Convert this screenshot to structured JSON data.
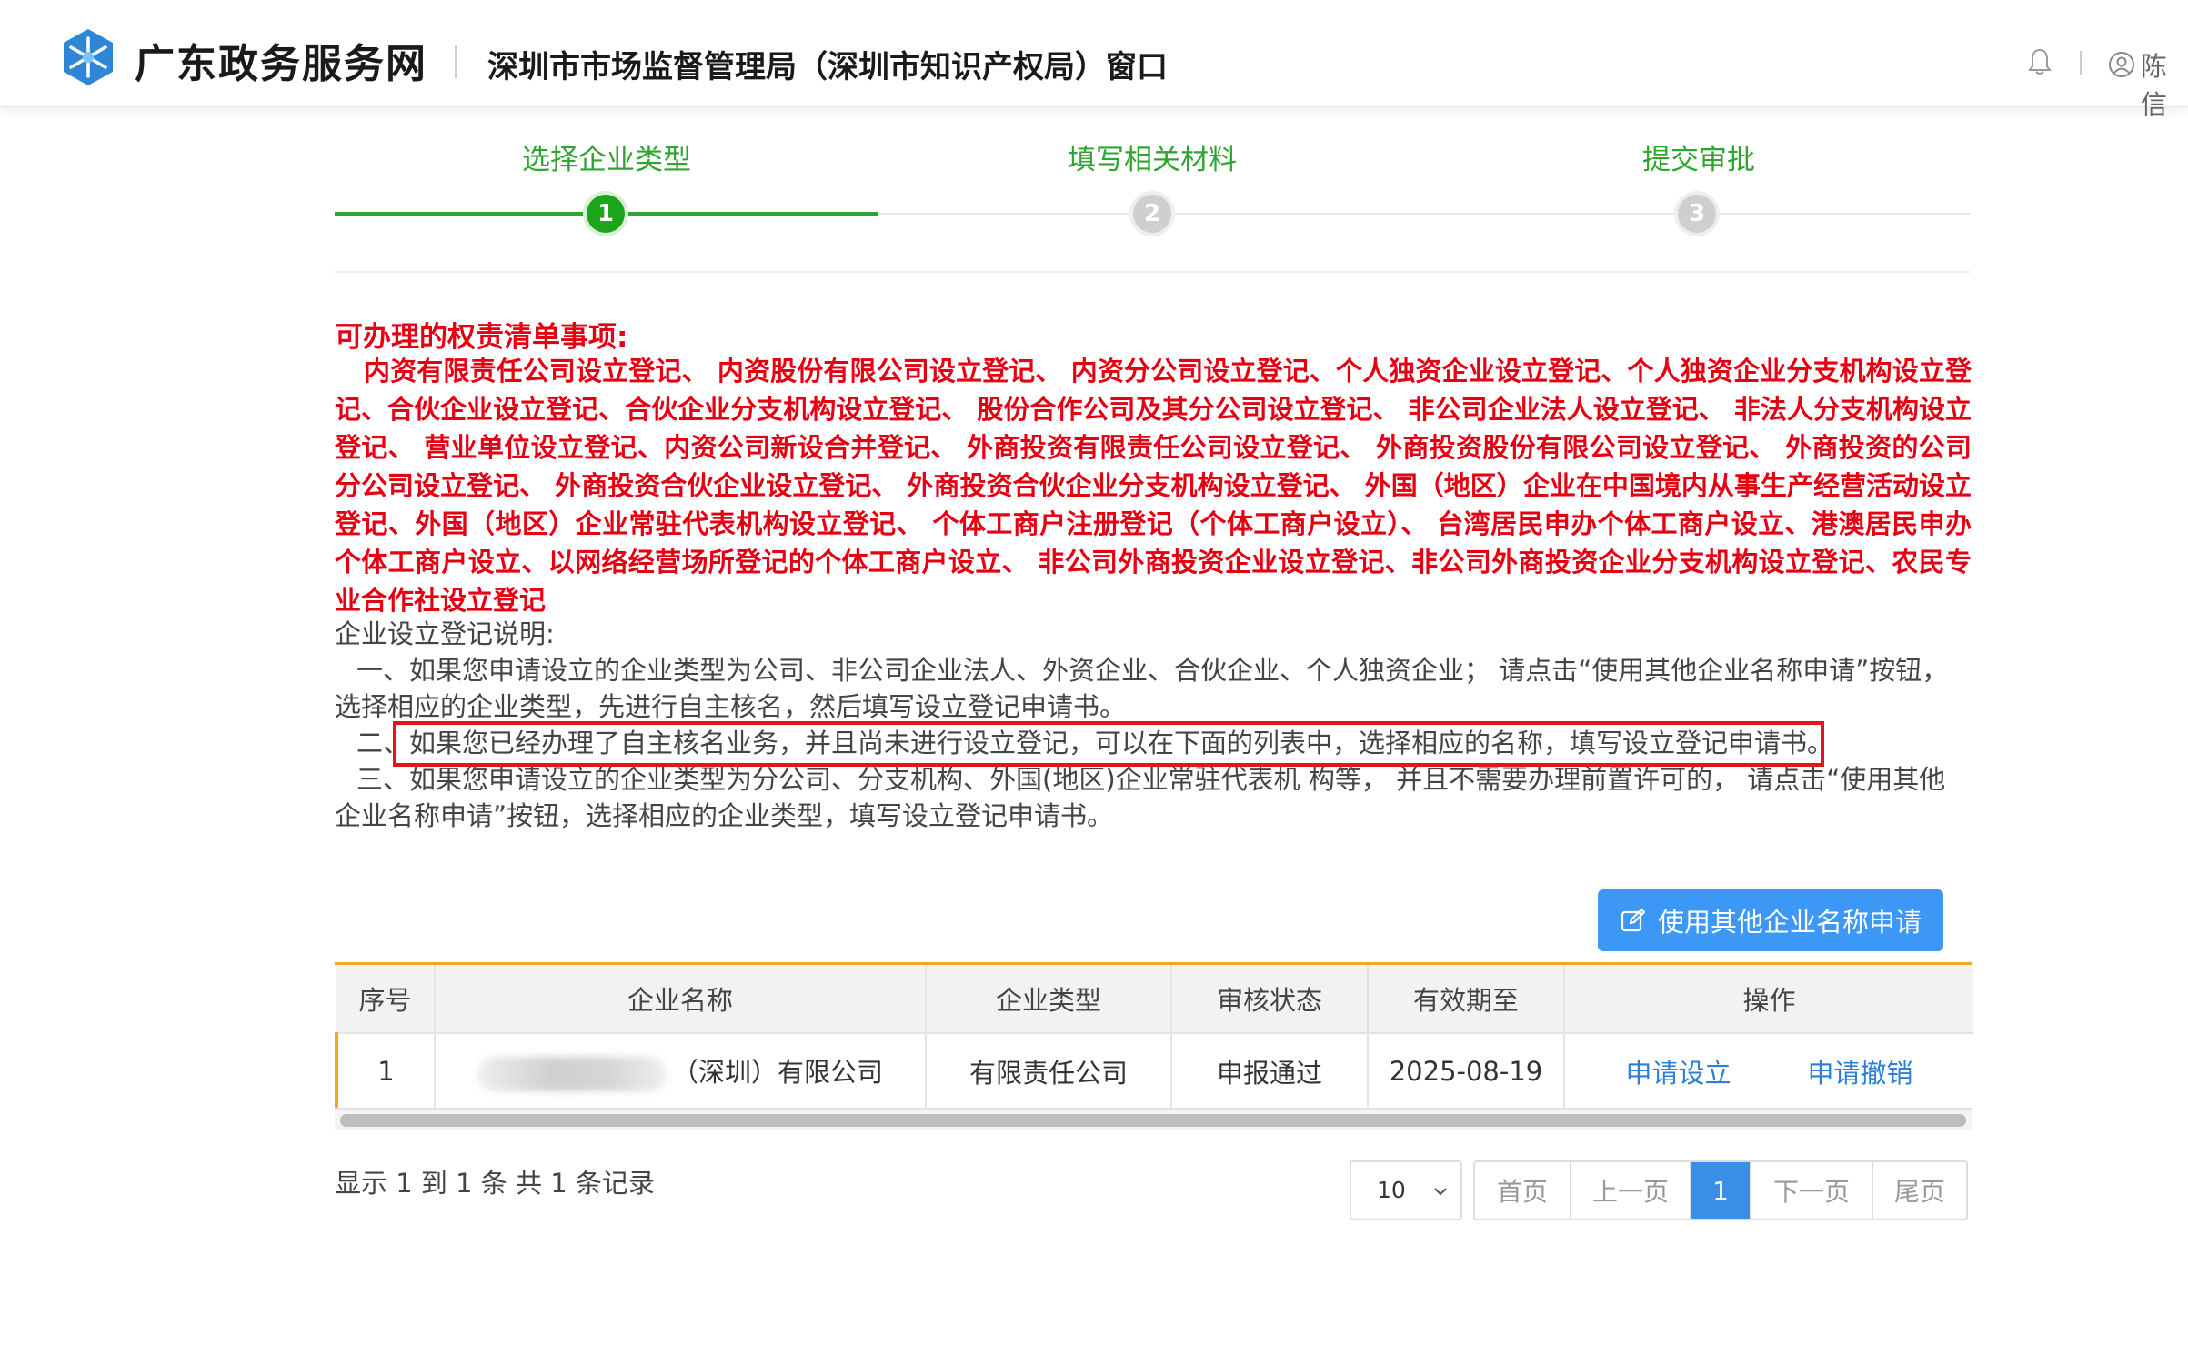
{
  "header": {
    "logo_text": "广东政务服务网",
    "title": "深圳市市场监督管理局（深圳市知识产权局）窗口",
    "user_name": "陈信"
  },
  "steps": [
    {
      "number": "1",
      "label": "选择企业类型",
      "state": "active"
    },
    {
      "number": "2",
      "label": "填写相关材料",
      "state": "inactive"
    },
    {
      "number": "3",
      "label": "提交审批",
      "state": "inactive"
    }
  ],
  "notice": {
    "title": "可办理的权责清单事项:",
    "body": "内资有限责任公司设立登记、 内资股份有限公司设立登记、 内资分公司设立登记、个人独资企业设立登记、个人独资企业分支机构设立登记、合伙企业设立登记、合伙企业分支机构设立登记、 股份合作公司及其分公司设立登记、 非公司企业法人设立登记、 非法人分支机构设立登记、 营业单位设立登记、内资公司新设合并登记、 外商投资有限责任公司设立登记、 外商投资股份有限公司设立登记、 外商投资的公司分公司设立登记、 外商投资合伙企业设立登记、 外商投资合伙企业分支机构设立登记、 外国（地区）企业在中国境内从事生产经营活动设立登记、外国（地区）企业常驻代表机构设立登记、 个体工商户注册登记（个体工商户设立）、 台湾居民申办个体工商户设立、港澳居民申办个体工商户设立、以网络经营场所登记的个体工商户设立、 非公司外商投资企业设立登记、非公司外商投资企业分支机构设立登记、农民专业合作社设立登记"
  },
  "description": {
    "heading": "企业设立登记说明:",
    "item1": "一、如果您申请设立的企业类型为公司、非公司企业法人、外资企业、合伙企业、个人独资企业； 请点击“使用其他企业名称申请”按钮，选择相应的企业类型，先进行自主核名，然后填写设立登记申请书。",
    "item2": "二、如果您已经办理了自主核名业务，并且尚未进行设立登记，可以在下面的列表中，选择相应的名称，填写设立登记申请书。",
    "item3": "三、如果您申请设立的企业类型为分公司、分支机构、外国(地区)企业常驻代表机 构等， 并且不需要办理前置许可的， 请点击“使用其他企业名称申请”按钮，选择相应的企业类型，填写设立登记申请书。"
  },
  "other_name_button": "使用其他企业名称申请",
  "table": {
    "columns": [
      "序号",
      "企业名称",
      "企业类型",
      "审核状态",
      "有效期至",
      "操作"
    ],
    "rows": [
      {
        "index": "1",
        "name_suffix": "（深圳）有限公司",
        "type": "有限责任公司",
        "status": "申报通过",
        "valid_until": "2025-08-19",
        "action_apply": "申请设立",
        "action_revoke": "申请撤销"
      }
    ]
  },
  "footer": {
    "records": "显示 1 到 1 条 共 1 条记录",
    "page_size": "10",
    "first": "首页",
    "prev": "上一页",
    "current": "1",
    "next": "下一页",
    "last": "尾页"
  },
  "colors": {
    "accent_green": "#2ea52e",
    "notice_red": "#e60012",
    "primary_blue": "#3d97f5",
    "table_accent": "#f5a623"
  }
}
